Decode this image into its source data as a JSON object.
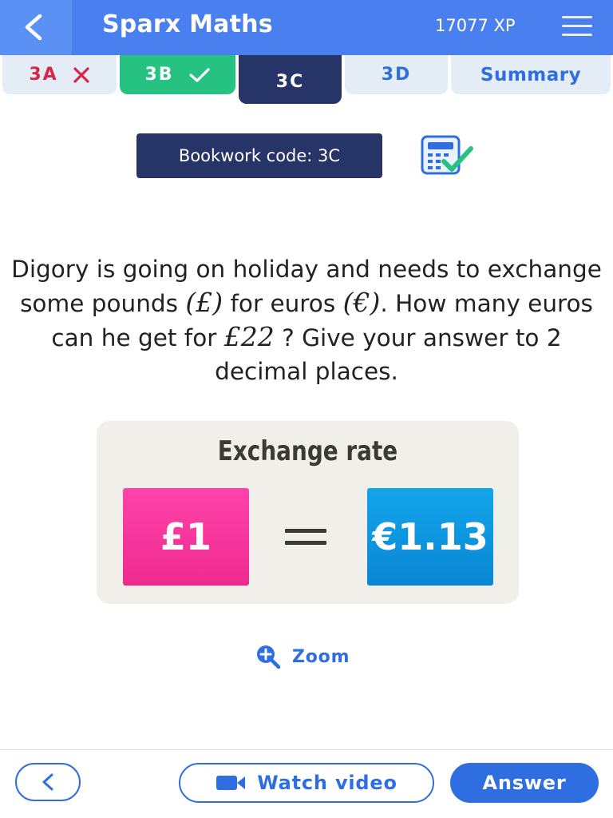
{
  "colors": {
    "header_bg": "#4a7ff0",
    "accent_blue": "#2f6ee0",
    "navy": "#263468",
    "success_green": "#26c281",
    "error_red": "#d6264a",
    "pound_box": "#ee2a90",
    "euro_box": "#0a86d4"
  },
  "header": {
    "title": "Sparx Maths",
    "xp": "17077 XP",
    "back_icon": "chevron-left-icon",
    "menu_icon": "hamburger-menu-icon"
  },
  "tabs": [
    {
      "label": "3A",
      "state": "incorrect",
      "icon": "cross-icon"
    },
    {
      "label": "3B",
      "state": "correct",
      "icon": "check-icon"
    },
    {
      "label": "3C",
      "state": "active"
    },
    {
      "label": "3D",
      "state": "pending"
    },
    {
      "label": "Summary",
      "state": "pending"
    }
  ],
  "bookwork": {
    "label": "Bookwork code: 3C",
    "icon": "bookwork-check-icon"
  },
  "question": {
    "part1": "Digory is going on holiday and needs to exchange some pounds ",
    "pound_symbol": "(£)",
    "part2": " for euros ",
    "euro_symbol": "(€)",
    "part3": ". How many euros can he get for ",
    "amount": "£22",
    "part4": " ? Give your answer to 2 decimal places."
  },
  "exchange_card": {
    "title": "Exchange rate",
    "left_value": "£1",
    "right_value": "€1.13"
  },
  "zoom": {
    "label": "Zoom",
    "icon": "zoom-in-icon"
  },
  "footer": {
    "back_icon": "chevron-left-icon",
    "watch_video_label": "Watch video",
    "video_icon": "video-camera-icon",
    "answer_label": "Answer"
  }
}
